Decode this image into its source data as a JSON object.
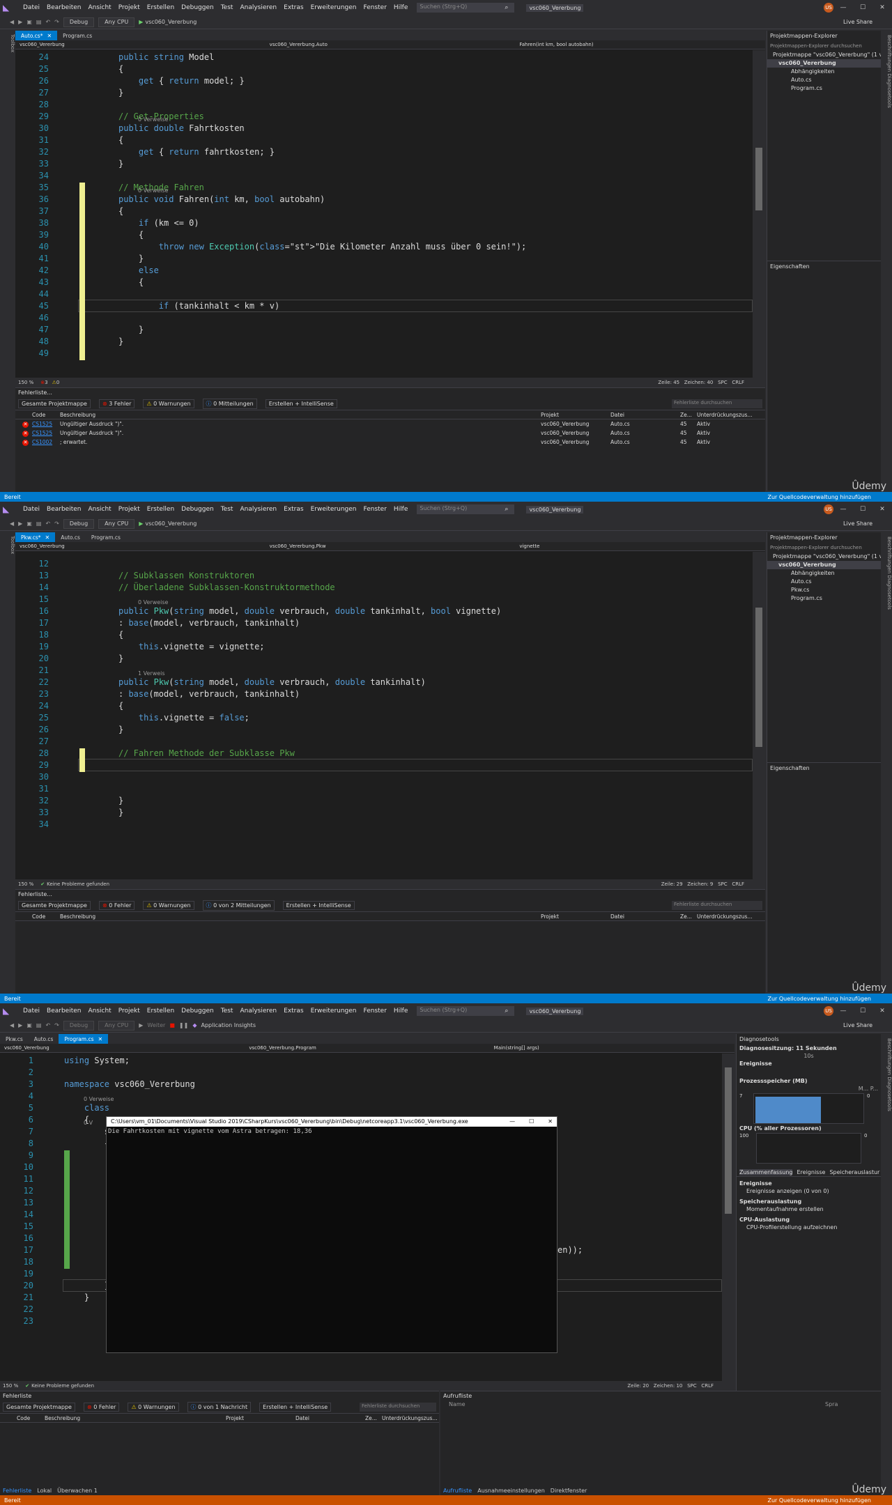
{
  "common": {
    "menu": [
      "Datei",
      "Bearbeiten",
      "Ansicht",
      "Projekt",
      "Erstellen",
      "Debuggen",
      "Test",
      "Analysieren",
      "Extras",
      "Erweiterungen",
      "Fenster",
      "Hilfe"
    ],
    "search_placeholder": "Suchen (Strg+Q)",
    "solution": "vsc060_Vererbung",
    "avatar": "US",
    "live_share": "Live Share",
    "toolbar": {
      "config": "Debug",
      "platform": "Any CPU",
      "start": "vsc060_Vererbung"
    },
    "udemy": "Ûdemy",
    "status_ready": "Bereit",
    "source_control": "Zur Quellcodeverwaltung hinzufügen",
    "error_list_title": "Fehlerliste...",
    "scope": "Gesamte Projektmappe",
    "build": "Erstellen + IntelliSense",
    "error_search": "Fehlerliste durchsuchen",
    "cols": {
      "code": "Code",
      "desc": "Beschreibung",
      "project": "Projekt",
      "file": "Datei",
      "line": "Ze...",
      "supp": "Unterdrückungszus..."
    },
    "toolbox": "Toolbox",
    "right_strip": "Beschriftungen    Diagnosetools"
  },
  "screen1": {
    "tabs": [
      {
        "label": "Auto.cs*",
        "active": true
      },
      {
        "label": "Program.cs",
        "active": false
      }
    ],
    "nav": [
      "vsc060_Vererbung",
      "vsc060_Vererbung.Auto",
      "Fahren(int km, bool autobahn)"
    ],
    "zoom": "150 %",
    "issues": "3",
    "warns": "0",
    "position": {
      "zeile": "Zeile: 45",
      "zeichen": "Zeichen: 40",
      "spc": "SPC",
      "crlf": "CRLF"
    },
    "counts": {
      "errors": "3 Fehler",
      "warnings": "0 Warnungen",
      "messages": "0 Mitteilungen"
    },
    "errors": [
      {
        "code": "CS1525",
        "desc": "Ungültiger Ausdruck \")\".",
        "project": "vsc060_Vererbung",
        "file": "Auto.cs",
        "line": "45",
        "supp": "Aktiv"
      },
      {
        "code": "CS1525",
        "desc": "Ungültiger Ausdruck \")\".",
        "project": "vsc060_Vererbung",
        "file": "Auto.cs",
        "line": "45",
        "supp": "Aktiv"
      },
      {
        "code": "CS1002",
        "desc": "; erwartet.",
        "project": "vsc060_Vererbung",
        "file": "Auto.cs",
        "line": "45",
        "supp": "Aktiv"
      }
    ],
    "explorer": {
      "title": "Projektmappen-Explorer",
      "search": "Projektmappen-Explorer durchsuchen",
      "items": [
        "Projektmappe \"vsc060_Vererbung\" (1 v",
        "vsc060_Vererbung",
        "Abhängigkeiten",
        "Auto.cs",
        "Program.cs"
      ]
    },
    "props_title": "Eigenschaften"
  },
  "screen2": {
    "tabs": [
      {
        "label": "Pkw.cs*",
        "active": true
      },
      {
        "label": "Auto.cs",
        "active": false
      },
      {
        "label": "Program.cs",
        "active": false
      }
    ],
    "nav": [
      "vsc060_Vererbung",
      "vsc060_Vererbung.Pkw",
      "vignette"
    ],
    "zoom": "150 %",
    "problems": "Keine Probleme gefunden",
    "position": {
      "zeile": "Zeile: 29",
      "zeichen": "Zeichen: 9",
      "spc": "SPC",
      "crlf": "CRLF"
    },
    "counts": {
      "errors": "0 Fehler",
      "warnings": "0 Warnungen",
      "messages": "0 von 2 Mitteilungen"
    },
    "explorer": {
      "title": "Projektmappen-Explorer",
      "search": "Projektmappen-Explorer durchsuchen",
      "items": [
        "Projektmappe \"vsc060_Vererbung\" (1 v",
        "vsc060_Vererbung",
        "Abhängigkeiten",
        "Auto.cs",
        "Pkw.cs",
        "Program.cs"
      ]
    },
    "props_title": "Eigenschaften"
  },
  "screen3": {
    "tabs": [
      {
        "label": "Pkw.cs",
        "active": false
      },
      {
        "label": "Auto.cs",
        "active": false
      },
      {
        "label": "Program.cs",
        "active": true
      }
    ],
    "nav": [
      "vsc060_Vererbung",
      "vsc060_Vererbung.Program",
      "Main(string[] args)"
    ],
    "zoom": "150 %",
    "problems": "Keine Probleme gefunden",
    "position": {
      "zeile": "Zeile: 20",
      "zeichen": "Zeichen: 10",
      "spc": "SPC",
      "crlf": "CRLF"
    },
    "counts": {
      "errors": "0 Fehler",
      "warnings": "0 Warnungen",
      "messages": "0 von 1 Nachricht"
    },
    "app_insights": "Application Insights",
    "weiter": "Weiter",
    "console_title": "C:\\Users\\vm_01\\Documents\\Visual Studio 2019\\CSharpKurs\\vsc060_Vererbung\\bin\\Debug\\netcoreapp3.1\\vsc060_Vererbung.exe",
    "console_output": "Die Fahrtkosten mit vignette vom Astra betragen: 18,36",
    "diag": {
      "title": "Diagnosetools",
      "session": "Diagnosesitzung: 11 Sekunden",
      "tick": "10s",
      "events": "Ereignisse",
      "mem": "Prozessspeicher (MB)",
      "mem_legend": "M...   P...",
      "mem_max": "7",
      "mem_min": "0",
      "cpu": "CPU (% aller Prozessoren)",
      "cpu_max": "100",
      "cpu_min": "0",
      "tabs": [
        "Zusammenfassung",
        "Ereignisse",
        "Speicherauslastur"
      ],
      "sec_events": "Ereignisse",
      "show_events": "Ereignisse anzeigen (0 von 0)",
      "sec_mem": "Speicherauslastung",
      "snapshot": "Momentaufnahme erstellen",
      "sec_cpu": "CPU-Auslastung",
      "cpu_profile": "CPU-Profilerstellung aufzeichnen"
    },
    "error_list_title": "Fehlerliste",
    "output_title": "Aufrufliste",
    "output_col": "Name",
    "output_col2": "Spra",
    "bottom_tabs_left": [
      "Fehlerliste",
      "Lokal",
      "Überwachen 1"
    ],
    "bottom_tabs_right": [
      "Aufrufliste",
      "Ausnahmeeinstellungen",
      "Direktfenster"
    ]
  }
}
